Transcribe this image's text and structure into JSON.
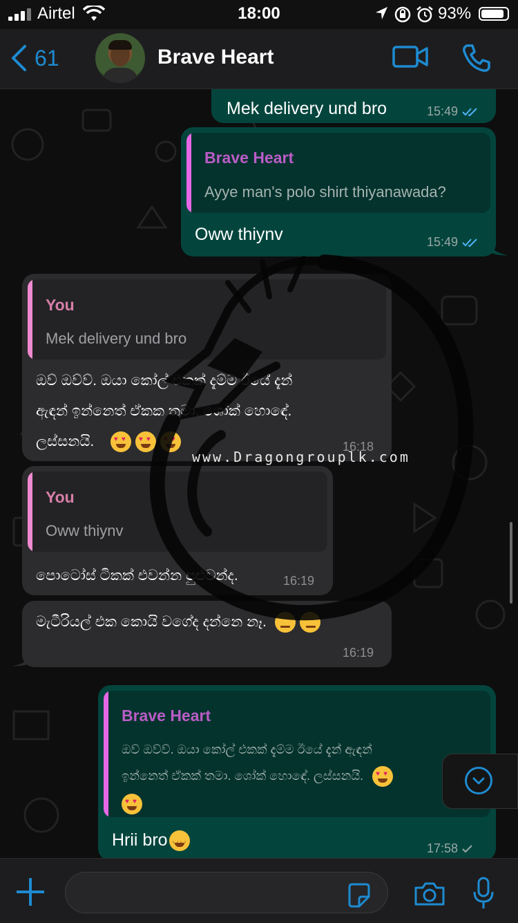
{
  "status_bar": {
    "carrier": "Airtel",
    "time": "18:00",
    "battery_percent": "93%"
  },
  "header": {
    "back_count": "61",
    "contact_name": "Brave Heart"
  },
  "messages": [
    {
      "text": "Mek delivery und bro",
      "time": "15:49"
    },
    {
      "quote_name": "Brave Heart",
      "quote_text": "Ayye man's polo shirt thiyanawada?",
      "text": "Oww thiynv",
      "time": "15:49"
    },
    {
      "quote_name": "You",
      "quote_text": "Mek delivery und bro",
      "line1": "ඔව් ඔව්ව්. ඔයා කෝල් එකක් දැම්ම ඊයේ  දැන්",
      "line2": "ඇඳන් ඉන්නෙත් ඒකක තමා. ශෝක් හොඳේ.",
      "line3": "ලස්සනයි.",
      "time": "16:18"
    },
    {
      "quote_name": "You",
      "quote_text": "Oww thiynv",
      "text": "පොටෝස් ටිකක් එවන්න පුළුවන්ද.",
      "time": "16:19"
    },
    {
      "text": "මැටීරියල් එක කොයි වගේද දන්නෙ නෑ.",
      "time": "16:19"
    },
    {
      "quote_name": "Brave Heart",
      "quote_line1": "ඔව් ඔව්ව්. ඔයා කෝල් එකක් දැම්ම ඊයේ  දැන් ඇඳන්",
      "quote_line2": "ඉන්නෙත් ඒකක් තමා. ශෝක් හොඳේ. ලස්සනයි.",
      "text": "Hrii bro",
      "time": "17:58"
    }
  ],
  "watermark": {
    "text": "www.Dragongrouplk.com"
  },
  "colors": {
    "accent": "#1e8bd1",
    "outgoing_bubble": "#03453d",
    "incoming_bubble": "#2c2c2e",
    "quote_name": "#bb5cc7",
    "read_ticks": "#4fb3f6"
  },
  "icons": [
    "back-chevron-icon",
    "video-call-icon",
    "phone-call-icon",
    "plus-icon",
    "sticker-icon",
    "camera-icon",
    "microphone-icon",
    "scroll-down-icon"
  ]
}
